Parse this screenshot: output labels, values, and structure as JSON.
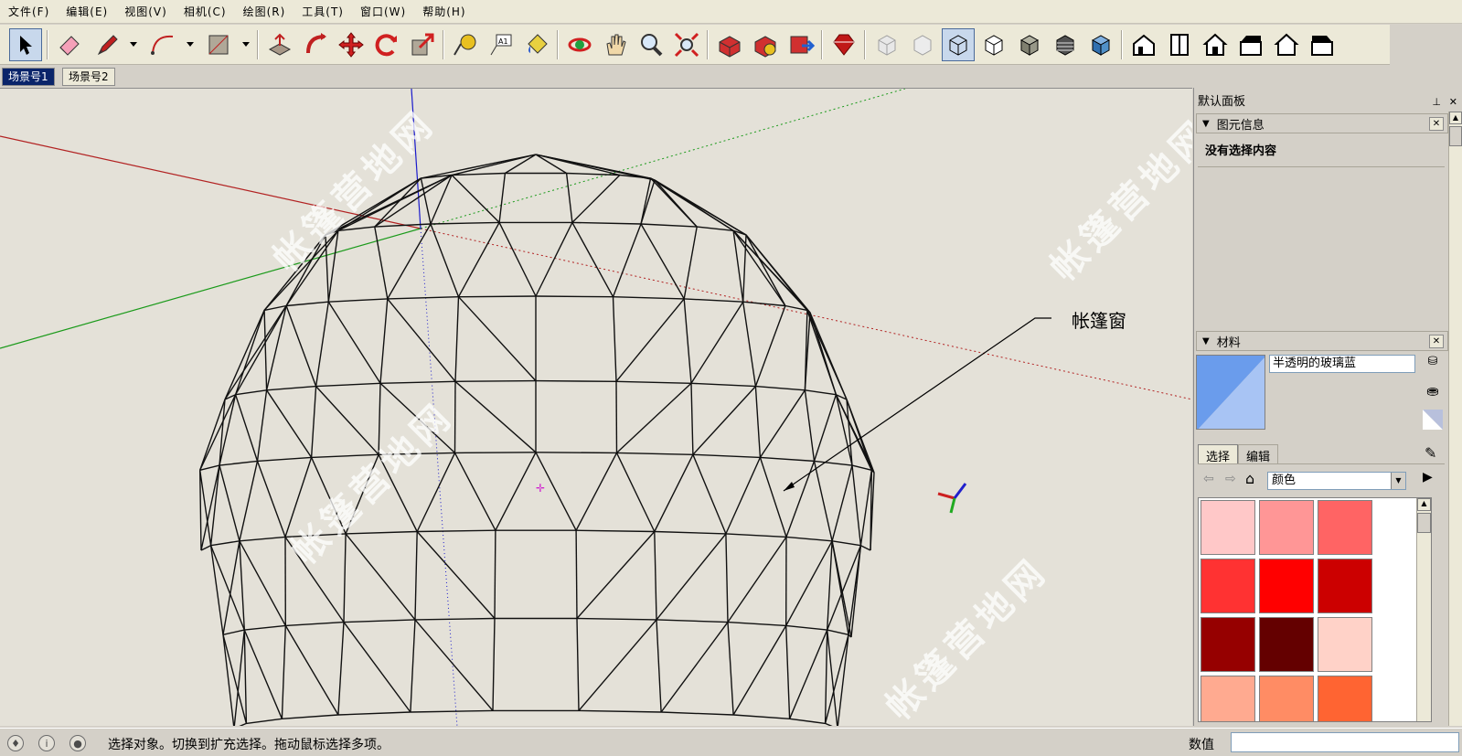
{
  "menubar": {
    "items": [
      "文件(F)",
      "编辑(E)",
      "视图(V)",
      "相机(C)",
      "绘图(R)",
      "工具(T)",
      "窗口(W)",
      "帮助(H)"
    ]
  },
  "toolbar": {
    "tools": [
      "select-tool",
      "eraser-tool",
      "pencil-tool",
      "arc-tool",
      "rectangle-tool",
      "push-pull-tool",
      "follow-me-tool",
      "move-tool",
      "rotate-tool",
      "scale-tool",
      "tape-measure-tool",
      "text-tool",
      "paint-bucket-tool",
      "orbit-tool",
      "pan-tool",
      "zoom-tool",
      "zoom-extents-tool",
      "component-tool",
      "warehouse-tool",
      "share-model-tool",
      "ruby-tool",
      "xray-style",
      "wireframe-style",
      "hidden-line-style",
      "shaded-style",
      "shaded-textures-style",
      "monochrome-style",
      "iso-view",
      "top-view",
      "front-view",
      "right-view",
      "back-view",
      "left-view"
    ]
  },
  "scenes": {
    "tabs": [
      "场景号1",
      "场景号2"
    ],
    "active": 0
  },
  "viewport": {
    "callout_label": "帐篷窗",
    "watermarks": [
      "帐篷营地网",
      "帐篷营地网",
      "帐篷营地网",
      "帐篷营地网",
      "帐篷营地网"
    ]
  },
  "panel": {
    "title": "默认面板",
    "entity_info": {
      "header": "图元信息",
      "empty_text": "没有选择内容"
    },
    "materials": {
      "header": "材料",
      "material_name": "半透明的玻璃蓝",
      "tabs": [
        "选择",
        "编辑"
      ],
      "category": "颜色",
      "swatch_colors": [
        "#ffc8c8",
        "#ff9696",
        "#ff6464",
        "#ff3232",
        "#ff0000",
        "#cc0000",
        "#960000",
        "#640000",
        "#ffd2c8",
        "#ffaa90",
        "#ff8c64",
        "#ff6432"
      ]
    }
  },
  "status": {
    "message": "选择对象。切换到扩充选择。拖动鼠标选择多项。",
    "value_label": "数值",
    "value": ""
  },
  "colors": {
    "axis_red": "#b22222",
    "axis_green": "#1a9a1a",
    "axis_blue": "#1a1acc",
    "material_blue": "#6a9cec"
  }
}
